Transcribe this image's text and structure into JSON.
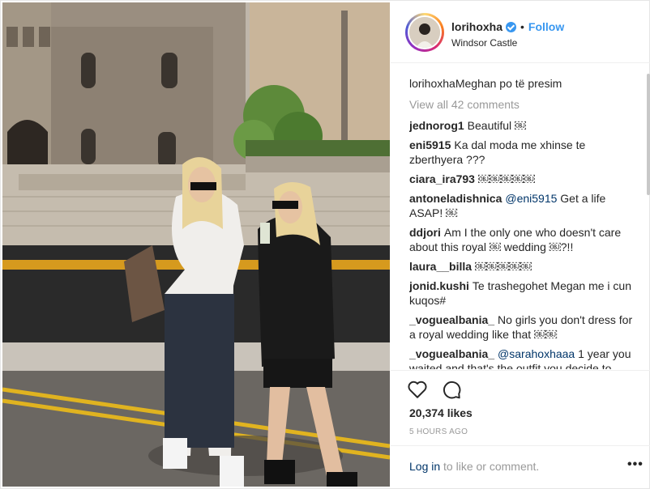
{
  "post": {
    "username": "lorihoxha",
    "follow_label": "Follow",
    "separator": "•",
    "location": "Windsor Castle"
  },
  "caption": {
    "user": "lorihoxha",
    "text": "Meghan po të presim"
  },
  "view_all_comments": "View all 42 comments",
  "comments": [
    {
      "user": "jednorog1",
      "text": "Beautiful ￼"
    },
    {
      "user": "eni5915",
      "text": "Ka dal moda me xhinse te zberthyera ???"
    },
    {
      "user": "ciara_ira793",
      "text": "￼￼￼￼￼"
    },
    {
      "user": "antoneladishnica",
      "mention": "@eni5915",
      "text": " Get a life ASAP! ￼"
    },
    {
      "user": "ddjori",
      "text": "Am I the only one who doesn't care about this royal ￼ wedding ￼?!!"
    },
    {
      "user": "laura__billa",
      "text": "￼￼￼￼￼"
    },
    {
      "user": "jonid.kushi",
      "text": "Te trashegohet Megan me i cun kuqos#"
    },
    {
      "user": "_voguealbania_",
      "text": "No girls you don't dress for a royal wedding like that ￼￼"
    },
    {
      "user": "_voguealbania_",
      "mention": "@sarahoxhaaa",
      "text": " 1 year you waited and that's the outfit you decide to"
    }
  ],
  "icons": {
    "like": "heart-outline-icon",
    "comment": "speech-bubble-icon",
    "more": "ellipsis-icon"
  },
  "likes_label": "20,374 likes",
  "time_label": "5 HOURS AGO",
  "login": {
    "link": "Log in",
    "text": " to like or comment.",
    "more_label": "•••"
  },
  "colors": {
    "accent": "#3897f0",
    "text": "#262626",
    "muted": "#999999",
    "link": "#003569"
  }
}
